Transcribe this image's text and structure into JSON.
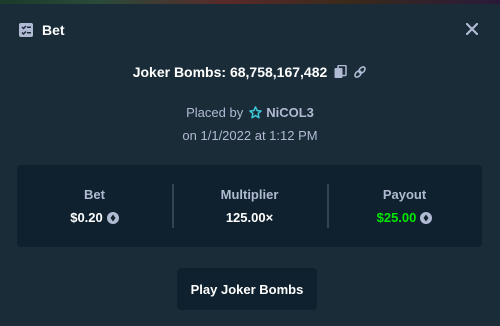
{
  "header": {
    "title": "Bet",
    "icon": "bet-slip-icon",
    "close_icon": "close-icon"
  },
  "game": {
    "name": "Joker Bombs: 68,758,167,482",
    "copy_icon": "copy-icon",
    "link_icon": "link-icon"
  },
  "placed": {
    "prefix": "Placed by",
    "user": "NiCOL3",
    "user_icon": "vip-star-icon",
    "date": "on 1/1/2022 at 1:12 PM"
  },
  "stats": {
    "bet": {
      "label": "Bet",
      "value": "$0.20"
    },
    "multiplier": {
      "label": "Multiplier",
      "value": "125.00×"
    },
    "payout": {
      "label": "Payout",
      "value": "$25.00"
    }
  },
  "actions": {
    "play_label": "Play Joker Bombs"
  },
  "colors": {
    "background": "#1a2c38",
    "panel": "#0f212e",
    "muted_text": "#b1bad3",
    "payout_green": "#00e701",
    "vip_teal": "#3bc8d8"
  }
}
